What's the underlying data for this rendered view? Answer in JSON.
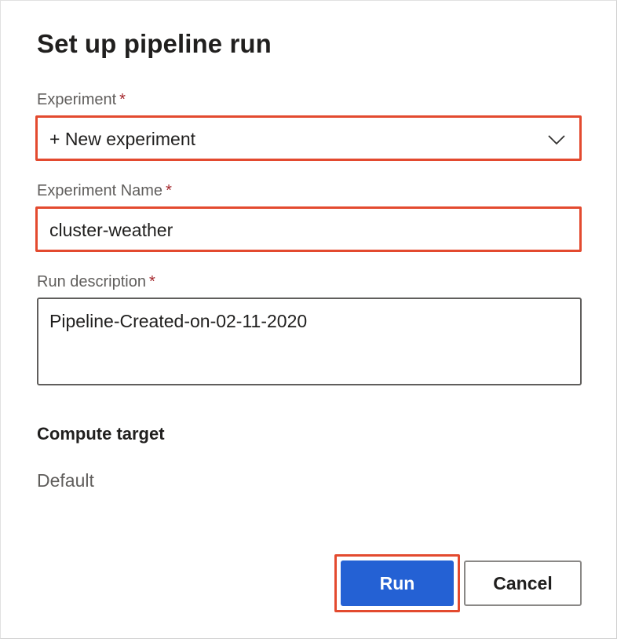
{
  "dialog": {
    "title": "Set up pipeline run"
  },
  "experiment": {
    "label": "Experiment",
    "required_mark": "*",
    "selected_value": "+ New experiment",
    "chevron_icon": "chevron-down-icon"
  },
  "experiment_name": {
    "label": "Experiment Name",
    "required_mark": "*",
    "value": "cluster-weather"
  },
  "run_description": {
    "label": "Run description",
    "required_mark": "*",
    "value": "Pipeline-Created-on-02-11-2020"
  },
  "compute_target": {
    "heading": "Compute target",
    "value": "Default"
  },
  "actions": {
    "run_label": "Run",
    "cancel_label": "Cancel"
  },
  "colors": {
    "primary": "#2461d4",
    "highlight": "#e34a2f",
    "required": "#a4262c"
  }
}
